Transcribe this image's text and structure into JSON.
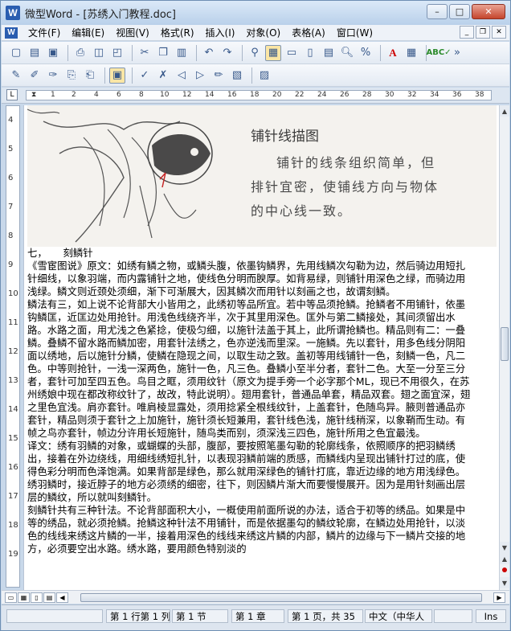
{
  "window": {
    "title": "微型Word - [苏绣入门教程.doc]",
    "app_icon": "W"
  },
  "controls": {
    "minimize": "–",
    "maximize": "□",
    "close": "✕"
  },
  "menu": [
    "文件(F)",
    "编辑(E)",
    "视图(V)",
    "格式(R)",
    "插入(I)",
    "对象(O)",
    "表格(A)",
    "窗口(W)"
  ],
  "mdi_controls": {
    "minimize": "_",
    "restore": "❐",
    "close": "✕"
  },
  "ruler": {
    "corner": "L",
    "numbers": [
      "1",
      "2",
      "4",
      "6",
      "8",
      "10",
      "12",
      "14",
      "16",
      "18",
      "20",
      "22",
      "24",
      "26",
      "28",
      "30",
      "32",
      "34",
      "36",
      "38",
      "40"
    ]
  },
  "vruler_numbers": [
    "4",
    "5",
    "6",
    "7",
    "8",
    "9",
    "10",
    "11",
    "12",
    "13",
    "14",
    "15",
    "16",
    "17",
    "18",
    "19"
  ],
  "figure": {
    "caption": "铺针线描图",
    "lines": [
      "铺针的线条组织简单，但",
      "排针宜密，使铺线方向与物体",
      "的中心线一致。"
    ]
  },
  "document": {
    "heading": "七，     刻鳞针",
    "paragraphs": [
      "《雪宦图说》原文：如绣有鳞之物，或鳞头腹，依墨钩鳞界，先用线鳞次勾勒为边，然后骑边用短扎针细线，以象羽端，而内露铺针之地，使线色分明而腴厚。如背易绿，则铺针用深色之绿，而骑边用浅绿。鳞文则近颈处须细，渐下可渐展大，因其鳞次而用针以刻画之也，故谓刻鳞。",
      "鳞法有三，如上说不论背部大小皆用之，此绣初等品所宜。若中等品须抢鳞。抢鳞者不用铺针，依墨钩鳞匡，近匡边处用抢针。用浅色线绕齐半，次于其里用深色。匡外与第二鳞接处，其间须留出水路。水路之面，用尤浅之色紧捻，使极匀细，以施针法盖于其上，此所谓抢鳞也。精品则有二：一叠鳞。叠鳞不留水路而鳞加密，用套针法绣之，色亦逆浅而里深。一施鳞。先以套针，用多色线分阴阳面以绣地，后以施针分鳞，使鳞在隐现之间，以取生动之致。盖初等用线铺针一色，刻鳞一色，凡二色。中等则抢针，一浅一深两色，施针一色，凡三色。叠鳞小至半分者，套针二色。大至一分至三分者，套针可加至四五色。鸟目之眶，须用纹针（原文为提手旁一个必字那个ML，现已不用很久，在苏州绣娘中现在都改称纹针了，故改，特此说明）。翅用套针，普通品单套，精品双套。翅之面宜深，翅之里色宜浅。肩亦套针。唯肩棱显露处，须用捻紧全根线纹针，上盖套针，色随鸟异。腋则普通品亦套针，精品则须于套针之上加施针，施针须长短兼用，套针线色浅，施针线稍深，以象鞘而生动。有帧之鸟亦套针，帧边分许用长短施针，随鸟类而别，须深浅三四色，施针所用之色宜最浅。",
      "译文：绣有羽鳞的对象，或蝴蝶的头部，腹部，要按照笔墨勾勒的轮廓线条，依照顺序的把羽鳞绣出，接着在外边绕线，用细线绣短扎针，以表现羽鳞前端的质感，而鳞线内呈现出铺针打过的底，使得色彩分明而色泽饱满。如果背部是绿色，那么就用深绿色的铺针打底，靠近边缘的地方用浅绿色。绣羽鳞时，接近脖子的地方必须绣的细密，往下，则因鳞片渐大而要慢慢展开。因为是用针刻画出层层的鳞纹，所以就叫刻鳞针。",
      "刻鳞针共有三种针法。不论背部面积大小，一概使用前面所说的办法，适合于初等的绣品。如果是中等的绣品，就必须抢鳞。抢鳞这种针法不用铺针，而是依据墨勾的鳞纹轮廓，在鳞边处用抢针，以淡色的线线来绣这片鳞的一半，接着用深色的线线来绣这片鳞的内部，鳞片的边缘与下一鳞片交接的地方，必须要空出水路。绣水路，要用颜色特别淡的"
    ]
  },
  "statusbar": {
    "position": "第 1 行第 1 列",
    "section": "第 1 节",
    "chapter": "第 1 章",
    "page": "第 1 页，共 35",
    "language": "中文（中华人",
    "mode": "Ins"
  }
}
